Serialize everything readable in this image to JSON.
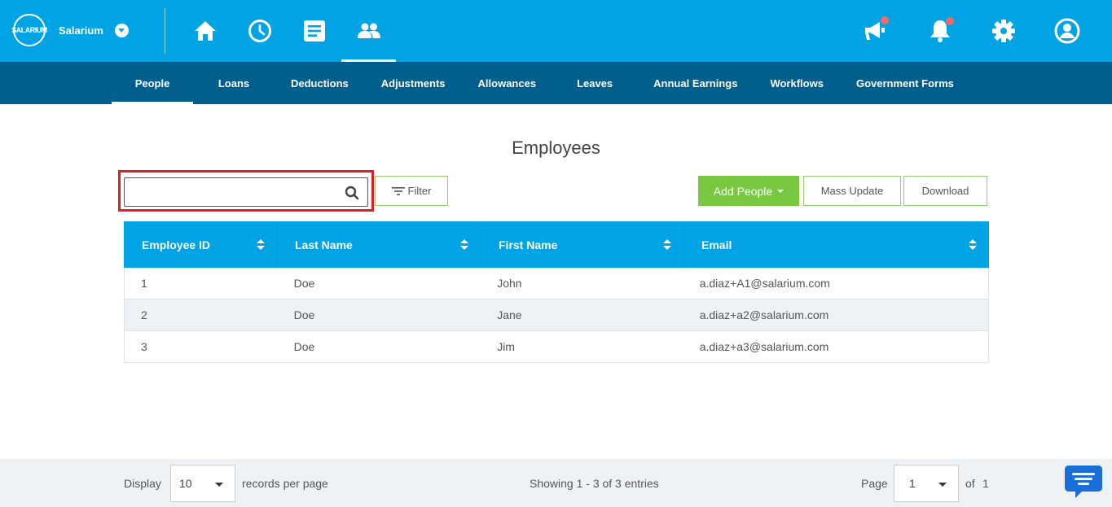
{
  "brand": {
    "logo_text": "SALARIUM",
    "name": "Salarium"
  },
  "main_nav": [
    "home-icon",
    "clock-icon",
    "document-icon",
    "people-icon"
  ],
  "right_nav": [
    "megaphone-icon",
    "bell-icon",
    "gear-icon",
    "user-icon"
  ],
  "sub_nav": [
    "People",
    "Loans",
    "Deductions",
    "Adjustments",
    "Allowances",
    "Leaves",
    "Annual Earnings",
    "Workflows",
    "Government Forms"
  ],
  "page": {
    "title": "Employees"
  },
  "search": {
    "value": "",
    "placeholder": ""
  },
  "toolbar": {
    "filter": "Filter",
    "add_people": "Add People",
    "mass_update": "Mass Update",
    "download": "Download"
  },
  "table": {
    "columns": [
      "Employee ID",
      "Last Name",
      "First Name",
      "Email"
    ],
    "rows": [
      [
        "1",
        "Doe",
        "John",
        "a.diaz+A1@salarium.com"
      ],
      [
        "2",
        "Doe",
        "Jane",
        "a.diaz+a2@salarium.com"
      ],
      [
        "3",
        "Doe",
        "Jim",
        "a.diaz+a3@salarium.com"
      ]
    ]
  },
  "footer": {
    "display_label": "Display",
    "per_page": "10",
    "records_label": "records per page",
    "showing": "Showing 1 - 3 of 3 entries",
    "page_label": "Page",
    "page_value": "1",
    "of_label": "of",
    "total_pages": "1"
  },
  "colors": {
    "primary": "#00a4e4",
    "subnav": "#005f8c",
    "accent_green": "#78c842",
    "highlight": "#e11d25",
    "badge": "#f36b6b"
  }
}
